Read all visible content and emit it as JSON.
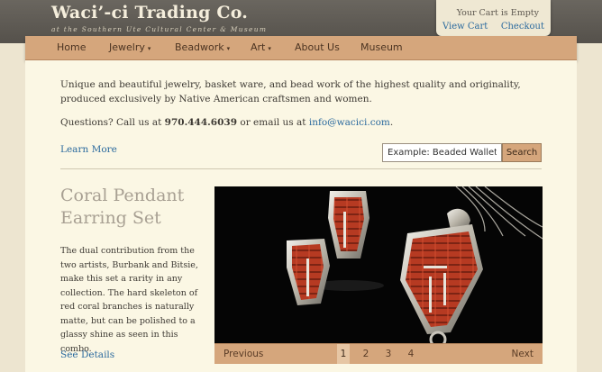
{
  "brand": {
    "title": "Waci’-ci Trading Co.",
    "subtitle": "at the Southern Ute Cultural Center & Museum"
  },
  "cart": {
    "status": "Your Cart is Empty",
    "view_label": "View Cart",
    "checkout_label": "Checkout"
  },
  "nav": {
    "items": [
      {
        "label": "Home"
      },
      {
        "label": "Jewelry",
        "dropdown": true
      },
      {
        "label": "Beadwork",
        "dropdown": true
      },
      {
        "label": "Art",
        "dropdown": true
      },
      {
        "label": "About Us"
      },
      {
        "label": "Museum"
      }
    ],
    "caret": "▾"
  },
  "intro": {
    "text": "Unique and beautiful jewelry, basket ware, and bead work of the highest quality and originality, produced exclusively by Native American craftsmen and women.",
    "questions_prefix": "Questions? Call us at ",
    "phone": "970.444.6039",
    "email_prefix": " or email us at ",
    "email": "info@wacici.com",
    "email_suffix": "."
  },
  "learn_more": "Learn More",
  "search": {
    "placeholder": "Example: Beaded Wallet",
    "button_label": "Search"
  },
  "feature": {
    "title": "Coral Pendant Earring Set",
    "description": "The dual contribution from the two artists, Burbank and Bitsie, make this set a rarity in any collection. The hard skeleton of red coral branches is naturally matte, but can be polished to a glassy shine as seen in this combo.",
    "details_label": "See Details"
  },
  "pager": {
    "prev_label": "Previous",
    "next_label": "Next",
    "pages": [
      "1",
      "2",
      "3",
      "4"
    ],
    "current": "1"
  },
  "colors": {
    "header": "#5e5a54",
    "nav": "#d5a67c",
    "content_bg": "#fbf7e4",
    "link": "#2b6a9e",
    "coral": "#b63a22"
  }
}
